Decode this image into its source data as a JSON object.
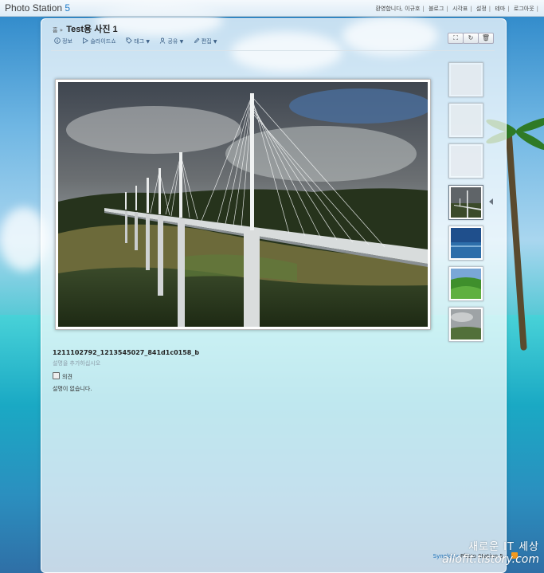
{
  "app": {
    "logo_name": "Photo Station",
    "logo_version": "5"
  },
  "header": {
    "links": [
      "환영합니다, 이규호",
      "블로그",
      "시각표",
      "설정",
      "테마",
      "로그아웃"
    ]
  },
  "breadcrumb": {
    "home": "홈",
    "separator": "»",
    "title": "Test용 사진 1"
  },
  "toolbar": {
    "info": "정보",
    "slideshow": "슬라이드쇼",
    "tag": "태그",
    "share": "공유",
    "edit": "편집"
  },
  "photo": {
    "filename": "1211102792_1213545027_841d1c0158_b",
    "description_placeholder": "설명을 추가하십시오",
    "comment_label": "의견",
    "no_description": "설명이 없습니다."
  },
  "thumbnails": [
    {
      "kind": "empty"
    },
    {
      "kind": "empty"
    },
    {
      "kind": "empty"
    },
    {
      "kind": "bridge",
      "selected": true
    },
    {
      "kind": "sea"
    },
    {
      "kind": "green-hills"
    },
    {
      "kind": "cloudy-field"
    }
  ],
  "view_buttons": [
    "fullscreen-icon",
    "refresh-icon",
    "trash-icon"
  ],
  "footer": {
    "brand": "Synology",
    "product": "Photo Station 5",
    "feed_icon": "rss-icon"
  },
  "watermark": {
    "line1": "새로운 IT 세상",
    "line2": "allofit.tistory.com"
  }
}
